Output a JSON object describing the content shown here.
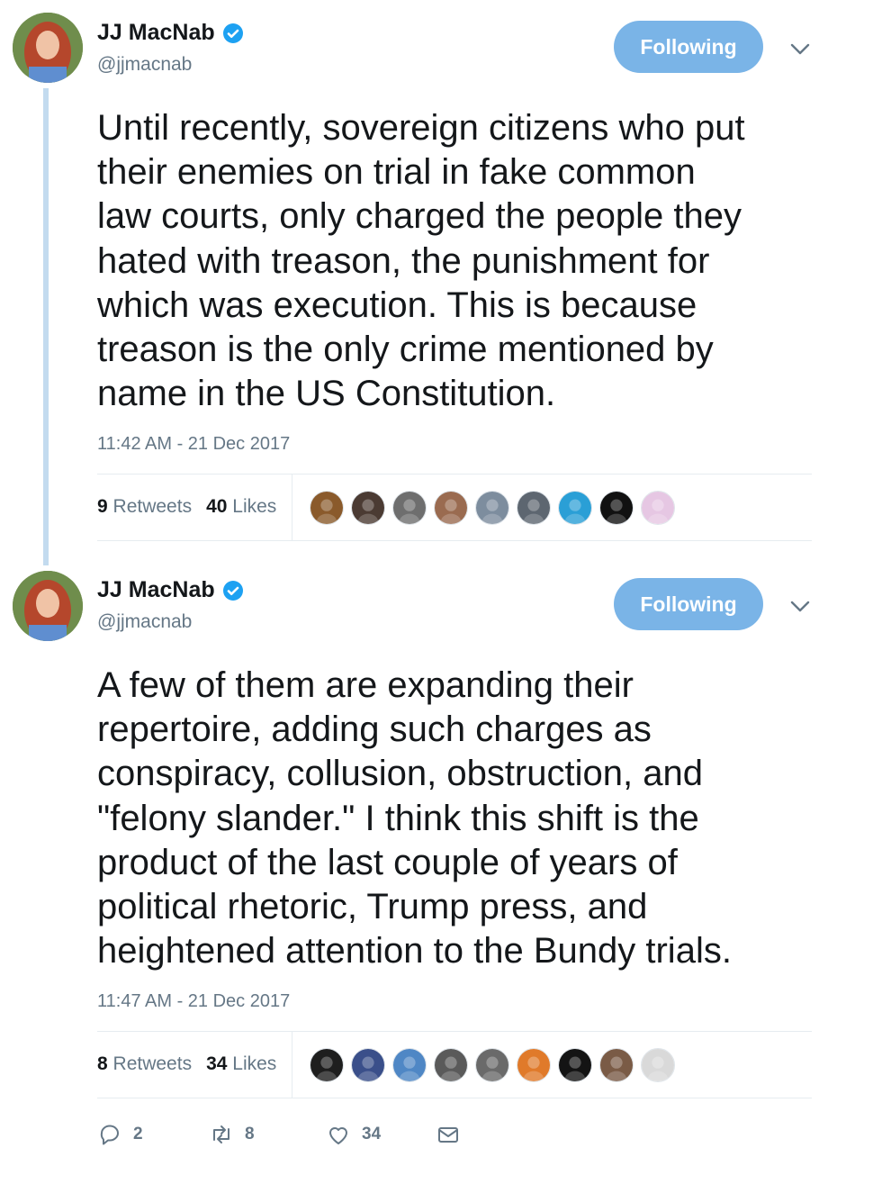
{
  "colors": {
    "text": "#14171a",
    "secondary": "#657786",
    "follow_button": "#7ab4e7",
    "verified": "#1da1f2",
    "thread_line": "#c3dbef",
    "divider": "#e6ecf0"
  },
  "tweets": [
    {
      "author_name": "JJ MacNab",
      "handle": "@jjmacnab",
      "verified_icon": "verified-badge-icon",
      "follow_label": "Following",
      "text": "Until recently, sovereign citizens who put\ntheir enemies on trial in fake common\nlaw courts, only charged the people they\nhated with treason, the punishment for\nwhich was execution.  This is because\ntreason is the only crime mentioned by\nname in the US Constitution.",
      "timestamp": "11:42 AM - 21 Dec 2017",
      "retweets_count": "9",
      "retweets_label": "Retweets",
      "likes_count": "40",
      "likes_label": "Likes",
      "liker_colors": [
        "#8a5a2b",
        "#4b3b33",
        "#6e6e6e",
        "#9a6b50",
        "#7d8d9e",
        "#5d6670",
        "#2a9fd6",
        "#111111",
        "#e6c7e3"
      ]
    },
    {
      "author_name": "JJ MacNab",
      "handle": "@jjmacnab",
      "verified_icon": "verified-badge-icon",
      "follow_label": "Following",
      "text": "A few of them are expanding their\nrepertoire, adding such charges as\nconspiracy, collusion, obstruction, and\n\"felony slander.\" I think this shift is the\nproduct of the last couple of years of\npolitical rhetoric, Trump press, and\nheightened attention to the Bundy trials.",
      "timestamp": "11:47 AM - 21 Dec 2017",
      "retweets_count": "8",
      "retweets_label": "Retweets",
      "likes_count": "34",
      "likes_label": "Likes",
      "liker_colors": [
        "#1e1e1e",
        "#3a4f8a",
        "#4f87c5",
        "#5a5a5a",
        "#6a6a6a",
        "#e07a2a",
        "#141414",
        "#7a5b46",
        "#d9d9d9"
      ]
    }
  ],
  "actions": {
    "reply_count": "2",
    "retweet_count": "8",
    "like_count": "34",
    "icons": [
      "reply-icon",
      "retweet-icon",
      "heart-icon",
      "envelope-icon"
    ]
  }
}
